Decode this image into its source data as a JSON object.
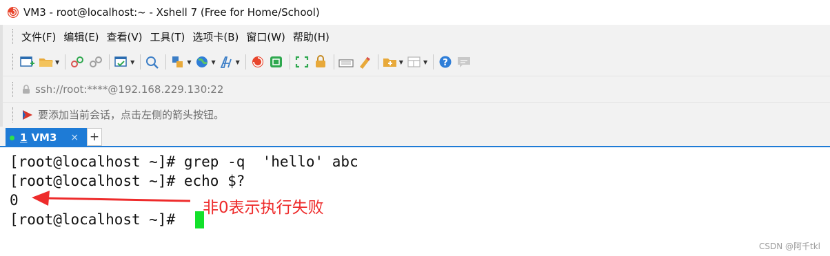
{
  "window": {
    "title": "VM3 - root@localhost:~ - Xshell 7 (Free for Home/School)",
    "app_icon": "xshell-app-icon"
  },
  "menu": {
    "items": [
      {
        "label": "文件(F)"
      },
      {
        "label": "编辑(E)"
      },
      {
        "label": "查看(V)"
      },
      {
        "label": "工具(T)"
      },
      {
        "label": "选项卡(B)"
      },
      {
        "label": "窗口(W)"
      },
      {
        "label": "帮助(H)"
      }
    ]
  },
  "toolbar": {
    "icons": [
      "new-session-icon",
      "open-folder-icon",
      "connect-icon",
      "disconnect-icon",
      "properties-icon",
      "find-icon",
      "transfer-icon",
      "globe-icon",
      "font-icon",
      "xshell-icon",
      "xftp-icon",
      "fullscreen-icon",
      "lock-icon",
      "keyboard-icon",
      "highlight-icon",
      "compose-icon",
      "layout-icon",
      "help-icon",
      "chat-icon"
    ]
  },
  "address": {
    "value": "ssh://root:****@192.168.229.130:22"
  },
  "info": {
    "text": "要添加当前会话，点击左侧的箭头按钮。"
  },
  "tabs": {
    "active": {
      "number": "1",
      "name": "VM3",
      "close": "×"
    },
    "add": "+"
  },
  "terminal": {
    "lines": [
      "[root@localhost ~]# grep -q  'hello' abc",
      "[root@localhost ~]# echo $?",
      "0",
      "[root@localhost ~]# "
    ],
    "annotation": "非0表示执行失败"
  },
  "watermark": "CSDN @阿千tkl",
  "colors": {
    "tab_accent": "#1e7bd6",
    "cursor": "#12e12a",
    "annotation": "#ee2b2b"
  }
}
